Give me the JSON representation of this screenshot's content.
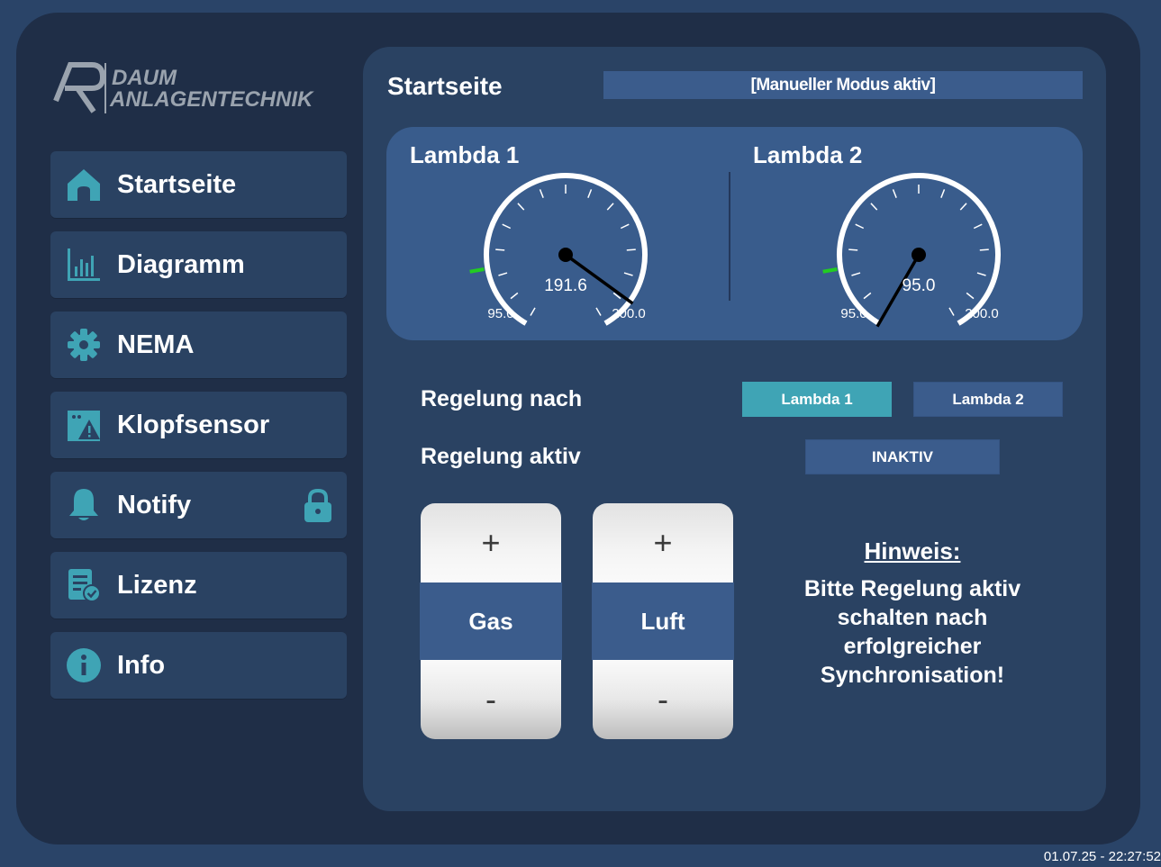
{
  "logo": {
    "line1": "DAUM",
    "line2": "ANLAGENTECHNIK"
  },
  "sidebar": {
    "items": [
      {
        "label": "Startseite",
        "icon": "home-icon"
      },
      {
        "label": "Diagramm",
        "icon": "bar-chart-icon"
      },
      {
        "label": "NEMA",
        "icon": "gear-icon"
      },
      {
        "label": "Klopfsensor",
        "icon": "warning-icon"
      },
      {
        "label": "Notify",
        "icon": "bell-icon",
        "locked": true
      },
      {
        "label": "Lizenz",
        "icon": "license-icon"
      },
      {
        "label": "Info",
        "icon": "info-icon"
      }
    ]
  },
  "header": {
    "title": "Startseite",
    "mode": "[Manueller Modus aktiv]"
  },
  "gauges": [
    {
      "title": "Lambda 1",
      "value": 191.6,
      "value_text": "191.6",
      "min": 95.0,
      "max": 200.0,
      "min_text": "95.0",
      "max_text": "200.0"
    },
    {
      "title": "Lambda 2",
      "value": 95.0,
      "value_text": "95.0",
      "min": 95.0,
      "max": 200.0,
      "min_text": "95.0",
      "max_text": "200.0"
    }
  ],
  "control": {
    "regelung_nach_label": "Regelung nach",
    "lambda1_button": "Lambda 1",
    "lambda2_button": "Lambda 2",
    "selected": "Lambda 1",
    "regelung_aktiv_label": "Regelung aktiv",
    "aktiv_state": "INAKTIV"
  },
  "steppers": {
    "gas": {
      "label": "Gas",
      "plus": "+",
      "minus": "-"
    },
    "luft": {
      "label": "Luft",
      "plus": "+",
      "minus": "-"
    }
  },
  "hint": {
    "title": "Hinweis:",
    "text": "Bitte Regelung aktiv schalten nach erfolgreicher Synchronisation!"
  },
  "timestamp": "01.07.25 - 22:27:52",
  "colors": {
    "accent": "#3fa4b5",
    "panel": "#2a4262",
    "gauge_panel": "#395c8c",
    "marker": "#22cc22"
  }
}
